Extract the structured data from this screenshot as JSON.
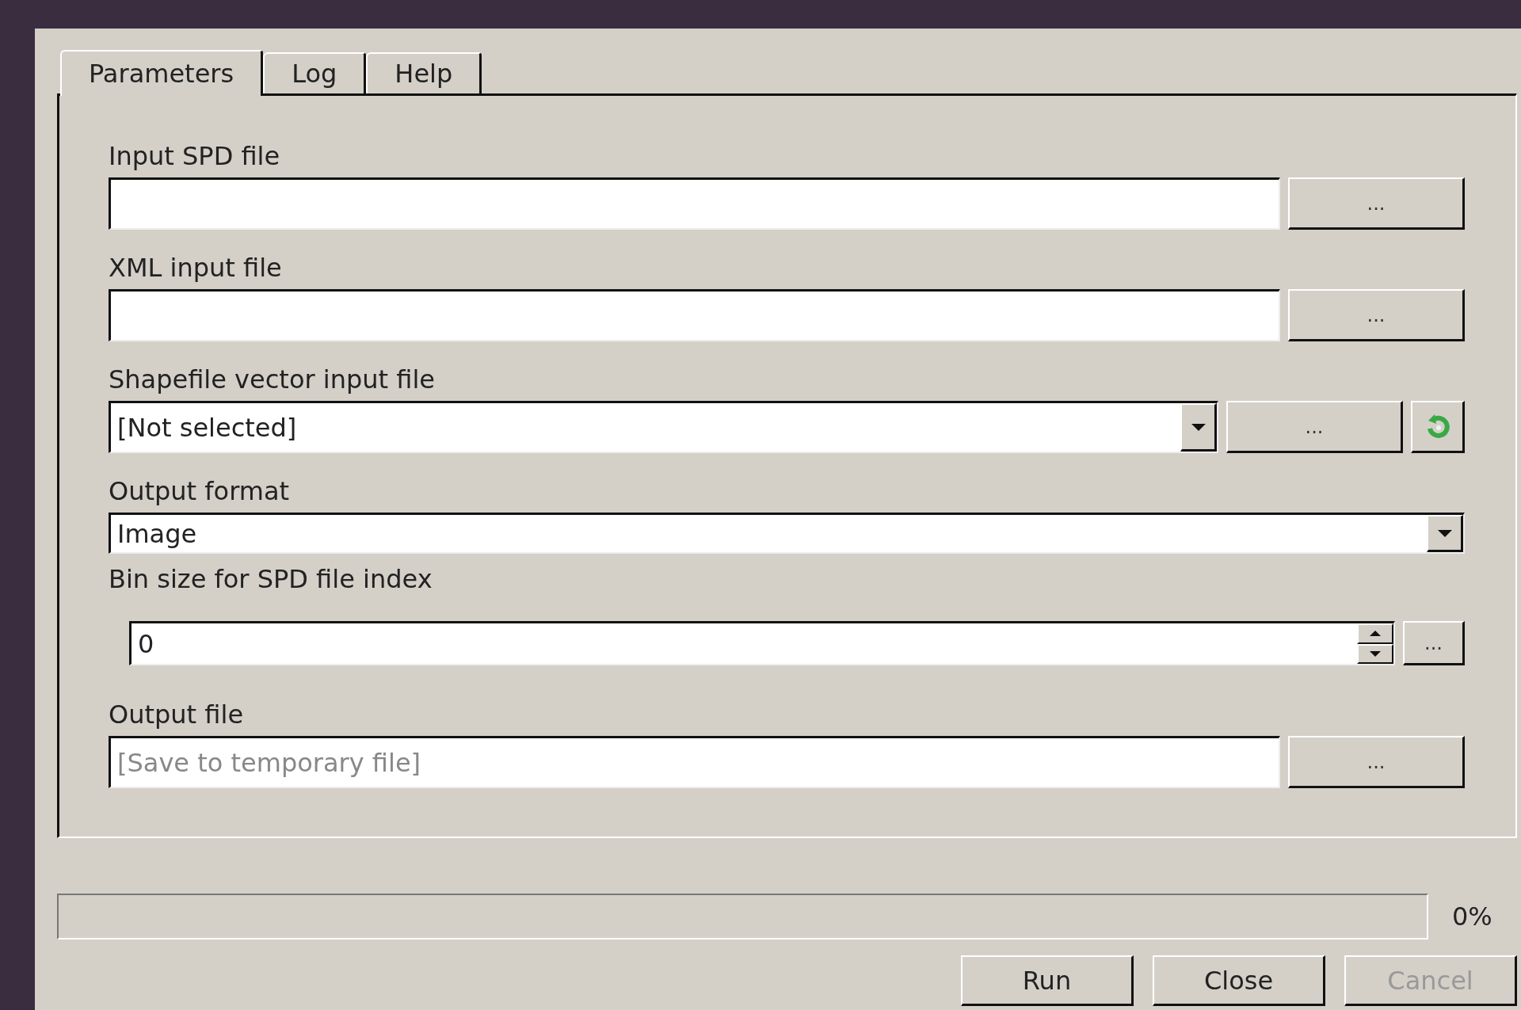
{
  "tabs": [
    {
      "label": "Parameters",
      "selected": true
    },
    {
      "label": "Log",
      "selected": false
    },
    {
      "label": "Help",
      "selected": false
    }
  ],
  "fields": [
    {
      "label": "Input SPD file",
      "kind": "file",
      "button": "..."
    },
    {
      "label": "XML input file",
      "kind": "file",
      "button": "..."
    },
    {
      "label": "Shapefile vector input file",
      "kind": "layer",
      "value": "[Not selected]",
      "button": "..."
    },
    {
      "label": "Output format",
      "kind": "select",
      "value": "Image"
    },
    {
      "label": "Bin size for SPD file index",
      "kind": "spin",
      "value": "0",
      "button": "..."
    },
    {
      "label": "Output file",
      "kind": "file",
      "placeholder": "[Save to temporary file]",
      "button": "..."
    }
  ],
  "progress": {
    "level": 0,
    "reading": "0%"
  },
  "buttons": [
    {
      "label": "Run",
      "disabled": false
    },
    {
      "label": "Close",
      "disabled": false
    },
    {
      "label": "Cancel",
      "disabled": true
    }
  ]
}
